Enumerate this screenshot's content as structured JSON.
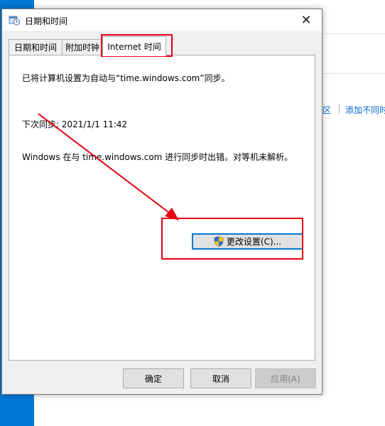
{
  "window": {
    "title": "日期和时间",
    "close_label": "✕"
  },
  "tabs": [
    {
      "label": "日期和时间"
    },
    {
      "label": "附加时钟"
    },
    {
      "label": "Internet 时间",
      "selected": true
    }
  ],
  "internet_time": {
    "sync_status": "已将计算机设置为自动与“time.windows.com”同步。",
    "next_sync": "下次同步: 2021/1/1 11:42",
    "error_message": "Windows 在与 time.windows.com 进行同步时出错。对等机未解析。",
    "change_settings_label": "更改设置(C)..."
  },
  "footer": {
    "ok_label": "确定",
    "cancel_label": "取消",
    "apply_label": "应用(A)",
    "apply_enabled": false
  },
  "background_window": {
    "link_left": "区",
    "link_right": "添加不同时"
  },
  "colors": {
    "annotation_red": "#e60012",
    "accent_blue": "#0078d7",
    "link_blue": "#0066cc"
  },
  "icons": {
    "title_icon": "clock-settings-icon",
    "button_icon": "uac-shield-icon"
  }
}
